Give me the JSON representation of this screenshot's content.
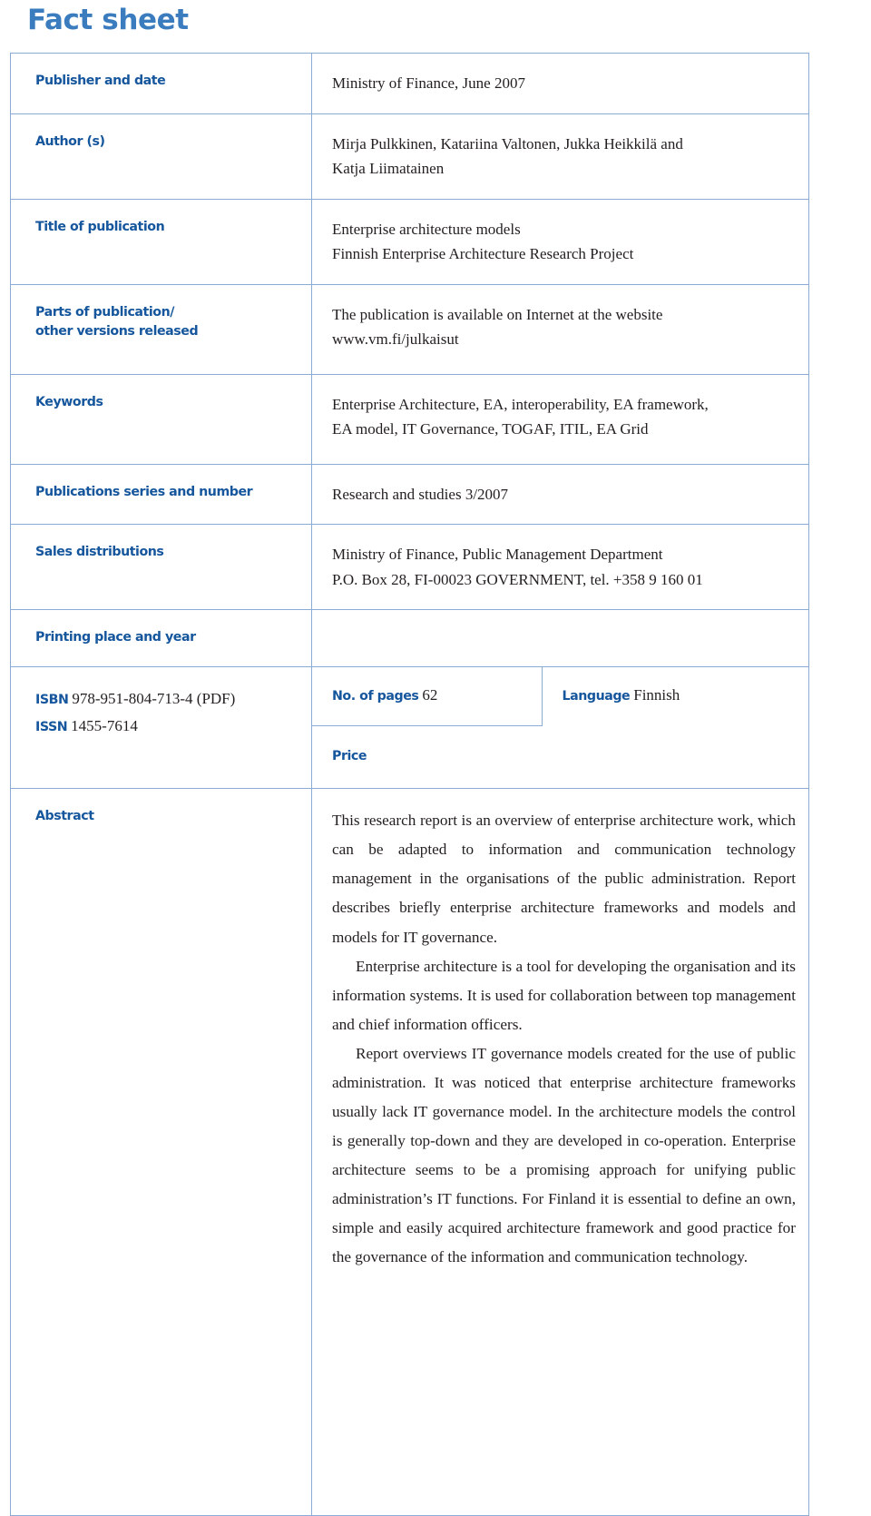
{
  "page": {
    "title": "Fact sheet"
  },
  "colors": {
    "title_blue": "#3a7cbe",
    "label_blue": "#15569d",
    "border_blue": "#8aabd4",
    "text_black": "#231f20"
  },
  "rows": {
    "publisher": {
      "label": "Publisher and date",
      "value": "Ministry of Finance, June 2007"
    },
    "author": {
      "label": "Author (s)",
      "value_lines": [
        "Mirja Pulkkinen, Katariina Valtonen, Jukka Heikkilä and",
        "Katja Liimatainen"
      ]
    },
    "title_of_publication": {
      "label": "Title of publication",
      "value_lines": [
        "Enterprise architecture models",
        "Finnish Enterprise Architecture Research Project"
      ]
    },
    "parts": {
      "label_lines": [
        "Parts of publication/",
        "other versions released"
      ],
      "value_lines": [
        "The publication is available on Internet at the website",
        "www.vm.fi/julkaisut"
      ]
    },
    "keywords": {
      "label": "Keywords",
      "value_lines": [
        "Enterprise Architecture, EA, interoperability, EA framework,",
        "EA model, IT Governance, TOGAF, ITIL, EA Grid"
      ]
    },
    "series": {
      "label": "Publications series and number",
      "value": "Research and studies 3/2007"
    },
    "sales": {
      "label": "Sales distributions",
      "value_lines": [
        "Ministry of Finance, Public Management Department",
        "P.O. Box 28, FI-00023 GOVERNMENT, tel. +358 9 160 01"
      ]
    },
    "printing": {
      "label": "Printing place and year",
      "value": ""
    },
    "isbn": {
      "label": "ISBN",
      "value": "978-951-804-713-4 (PDF)"
    },
    "issn": {
      "label": "ISSN",
      "value": "1455-7614"
    },
    "pages": {
      "label": "No. of pages",
      "value": "62"
    },
    "language": {
      "label": "Language",
      "value": "Finnish"
    },
    "price": {
      "label": "Price",
      "value": ""
    },
    "abstract": {
      "label": "Abstract",
      "paragraphs": [
        "This research report is an overview of enterprise architecture work, which can be adapted to information and communication technology management in the organisations of the public administration. Report describes briefly enterprise architecture frameworks and models and models for IT governance.",
        "Enterprise architecture is a tool for developing the organisation and its information systems. It is used for collaboration between top management and chief information officers.",
        "Report overviews IT governance models created for the use of public administration. It was noticed that enterprise architecture frameworks usually lack IT governance model. In the architecture models the control is generally top-down and they are developed in co-operation. Enterprise architecture seems to be a promising approach for unifying public administration’s IT functions. For Finland it is essential to define an own, simple and easily acquired architecture framework and good practice for the governance of the information and communication technology."
      ]
    }
  }
}
